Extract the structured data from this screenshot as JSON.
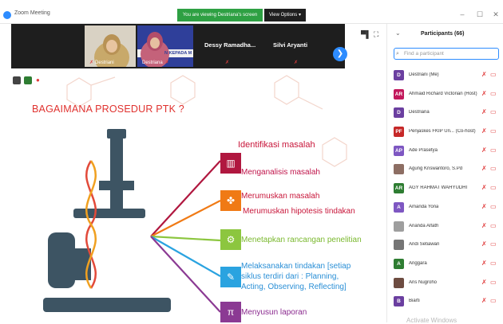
{
  "window": {
    "app_title": "Zoom Meeting",
    "banner": "You are viewing Destriana's screen",
    "view_options": "View Options ▾",
    "minimize": "–",
    "maximize": "☐",
    "close": "✕"
  },
  "strip": {
    "tiles": [
      {
        "name": "Destriani"
      },
      {
        "name": "Destriana",
        "overlay": "N KEPADA M"
      },
      {
        "name": "Dessy Ramadha..."
      },
      {
        "name": "Silvi Aryanti"
      }
    ],
    "next": "❯"
  },
  "slide": {
    "title": "BAGAIMANA PROSEDUR PTK ?",
    "heading": "Identifikasi masalah",
    "steps": [
      {
        "text": "Menganalisis masalah",
        "color": "#c0154b",
        "icon_color": "#b0173f",
        "icon": "bar-chart-icon"
      },
      {
        "text": "Merumuskan masalah",
        "color": "#c8163a",
        "icon_color": "#f07a15",
        "icon": "puzzle-icon"
      },
      {
        "text": "Merumuskan hipotesis tindakan",
        "color": "#c8163a"
      },
      {
        "text": "Menetapkan rancangan penelitian",
        "color": "#7ab82e",
        "icon_color": "#8cc63f",
        "icon": "gears-icon"
      },
      {
        "text": "Melaksanakan tindakan [setiap siklus terdiri dari : Planning, Acting, Observing, Reflecting]",
        "color": "#2a8fd6",
        "icon_color": "#2aa3e0",
        "icon": "palette-icon"
      },
      {
        "text": "Menyusun laporan",
        "color": "#8b2a8f",
        "icon_color": "#8b3a93",
        "icon": "pi-icon"
      }
    ]
  },
  "panel": {
    "title": "Participants (66)",
    "search_placeholder": "Find a participant",
    "watermark": "Activate Windows",
    "participants": [
      {
        "initials": "D",
        "color": "#6b3fa0",
        "name": "Destriani (Me)"
      },
      {
        "initials": "AR",
        "color": "#c2185b",
        "name": "Ahmaid Richard Victorian (Host)"
      },
      {
        "initials": "D",
        "color": "#6b3fa0",
        "name": "Destriana"
      },
      {
        "initials": "PF",
        "color": "#c62828",
        "name": "Penjaskes FKIP Un... (Co-host)"
      },
      {
        "initials": "AP",
        "color": "#7e57c2",
        "name": "Ade Prasetya"
      },
      {
        "initials": "",
        "color": "#8d6e63",
        "name": "Agung Kriswantoro, S.Pd"
      },
      {
        "initials": "AR",
        "color": "#2e7d32",
        "name": "AGY RAHMAT WAHYUDHI"
      },
      {
        "initials": "A",
        "color": "#7e57c2",
        "name": "Amanda Yona"
      },
      {
        "initials": "",
        "color": "#9e9e9e",
        "name": "Ananda Alfath"
      },
      {
        "initials": "",
        "color": "#757575",
        "name": "Andi Setiawan"
      },
      {
        "initials": "A",
        "color": "#2e7d32",
        "name": "Anggara"
      },
      {
        "initials": "",
        "color": "#6d4c41",
        "name": "Aris Nugroho"
      },
      {
        "initials": "B",
        "color": "#6b3fa0",
        "name": "Biarti"
      }
    ]
  }
}
